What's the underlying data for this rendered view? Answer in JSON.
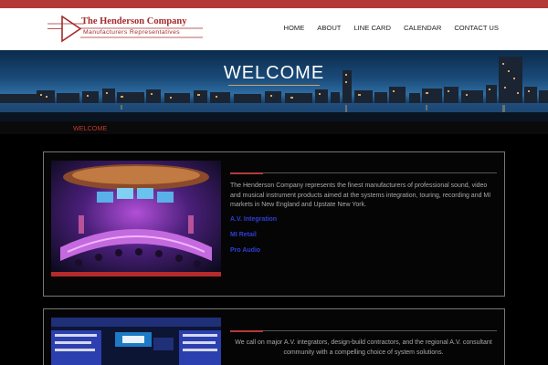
{
  "logo": {
    "title": "The Henderson Company",
    "subtitle": "Manufacturers Representatives",
    "accent": "#a32b2b"
  },
  "nav": {
    "items": [
      "HOME",
      "ABOUT",
      "LINE CARD",
      "CALENDAR",
      "CONTACT US"
    ]
  },
  "hero": {
    "title": "WELCOME"
  },
  "breadcrumb": {
    "current": "WELCOME"
  },
  "cards": [
    {
      "body": "The Henderson Company represents the finest manufacturers of professional sound, video and musical instrument products aimed at the systems integration, touring, recording and MI markets in New England and Upstate New York.",
      "links": [
        "A.V. Integration",
        "MI Retail",
        "Pro Audio"
      ]
    },
    {
      "body": "We call on major A.V. integrators, design-build contractors, and the regional A.V. consultant community with a compelling choice of system solutions."
    }
  ],
  "colors": {
    "brand_red": "#b43a3a",
    "link_blue": "#2e3fd6",
    "background": "#000000"
  }
}
